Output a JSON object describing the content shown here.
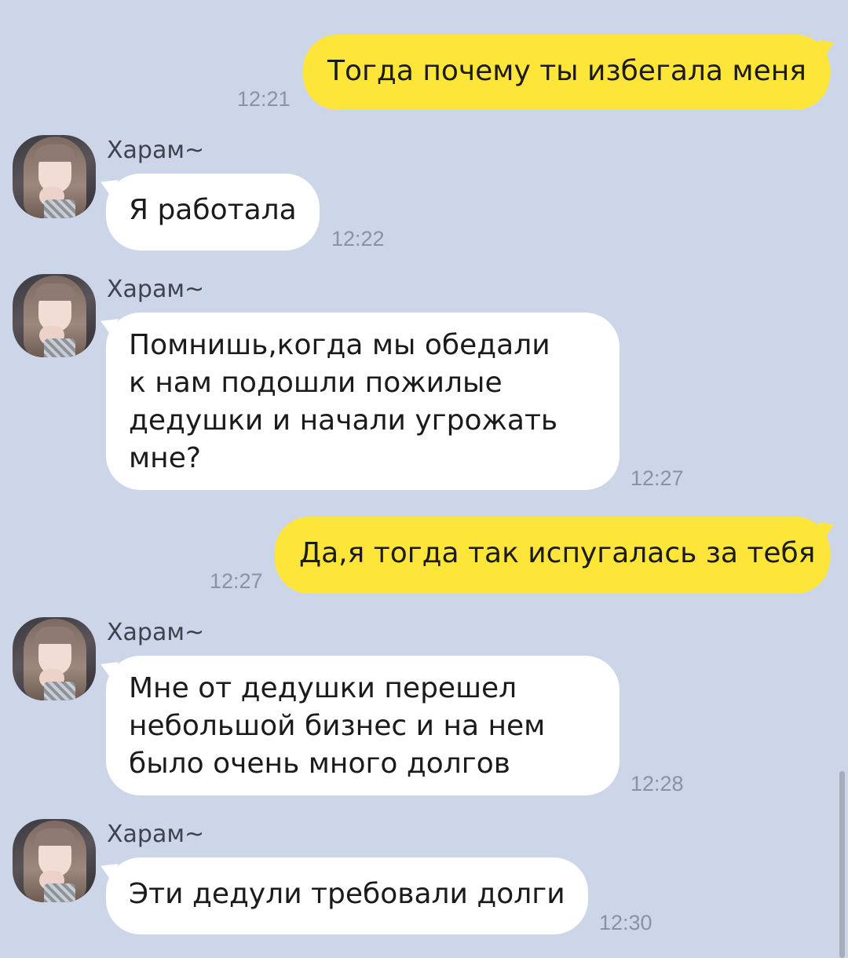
{
  "contact": {
    "name": "Харам~"
  },
  "messages": [
    {
      "direction": "outgoing",
      "text": "Тогда почему ты избегала меня",
      "time": "12:21"
    },
    {
      "direction": "incoming",
      "sender": "Харам~",
      "text": "Я работала",
      "time": "12:22"
    },
    {
      "direction": "incoming",
      "sender": "Харам~",
      "lines": [
        "Помнишь,когда мы обедали",
        "к нам подошли пожилые",
        "дедушки и начали угрожать",
        "мне?"
      ],
      "time": "12:27"
    },
    {
      "direction": "outgoing",
      "text": "Да,я тогда так испугалась за тебя",
      "time": "12:27"
    },
    {
      "direction": "incoming",
      "sender": "Харам~",
      "lines": [
        "Мне от дедушки перешел",
        "небольшой бизнес и на нем",
        "было очень много долгов"
      ],
      "time": "12:28"
    },
    {
      "direction": "incoming",
      "sender": "Харам~",
      "text": "Эти дедули требовали долги",
      "time": "12:30"
    }
  ],
  "colors": {
    "background": "#cdd6e8",
    "outgoing_bubble": "#fee53a",
    "incoming_bubble": "#ffffff",
    "timestamp": "#8a93a5"
  }
}
